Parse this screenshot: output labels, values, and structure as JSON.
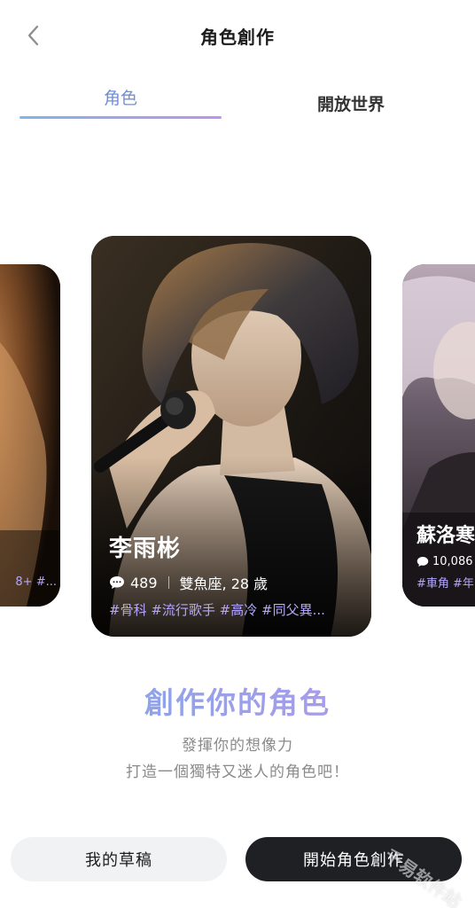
{
  "header": {
    "title": "角色創作",
    "back_icon": "chevron-left-icon"
  },
  "tabs": [
    {
      "label": "角色",
      "active": true
    },
    {
      "label": "開放世界",
      "active": false
    }
  ],
  "colors": {
    "accent_start": "#7fb6e8",
    "accent_end": "#c092ee",
    "tag": "#b4a6ff",
    "primary_button": "#1f2023"
  },
  "cards": {
    "left": {
      "tags": "8+ #..."
    },
    "center": {
      "name": "李雨彬",
      "chat_count": "489",
      "info": "雙魚座, 28 歲",
      "tags": "#骨科 #流行歌手 #高冷 #同父異..."
    },
    "right": {
      "name": "蘇洛寒",
      "chat_count": "10,086",
      "tags": "#車角 #年"
    }
  },
  "headline": "創作你的角色",
  "subtitle_line1": "發揮你的想像力",
  "subtitle_line2": "打造一個獨特又迷人的角色吧！",
  "buttons": {
    "draft": "我的草稿",
    "start": "開始角色創作"
  },
  "watermark": "千易软件站"
}
